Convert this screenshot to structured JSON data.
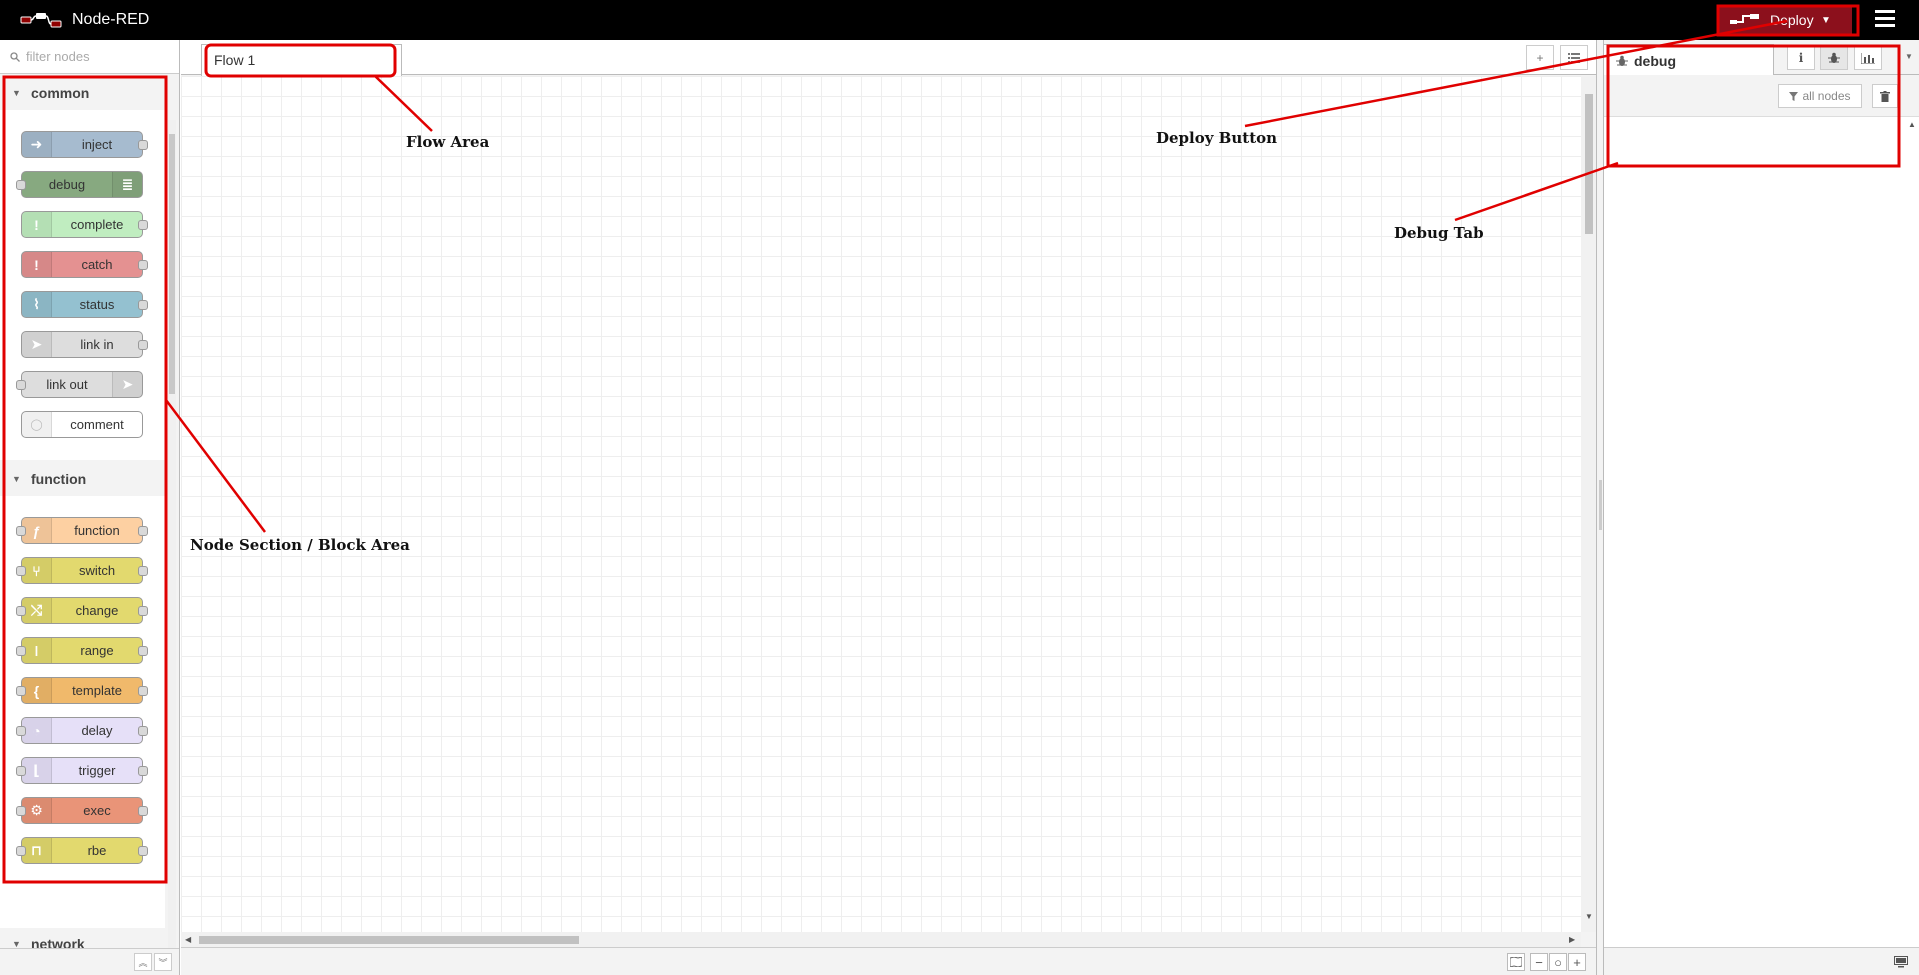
{
  "header": {
    "app_title": "Node-RED",
    "deploy_label": "Deploy"
  },
  "palette": {
    "search_placeholder": "filter nodes",
    "categories": [
      {
        "label": "common",
        "nodes": [
          {
            "label": "inject",
            "color": "#a6bbcf",
            "icon": "arrow-right-icon",
            "icon_side": "left",
            "in": false,
            "out": true
          },
          {
            "label": "debug",
            "color": "#87a980",
            "icon": "list-icon",
            "icon_side": "right",
            "in": true,
            "out": false
          },
          {
            "label": "complete",
            "color": "#c0edc0",
            "icon": "exclamation-icon",
            "icon_side": "left",
            "in": false,
            "out": true
          },
          {
            "label": "catch",
            "color": "#e49191",
            "icon": "exclamation-icon",
            "icon_side": "left",
            "in": false,
            "out": true
          },
          {
            "label": "status",
            "color": "#94c1d0",
            "icon": "pulse-icon",
            "icon_side": "left",
            "in": false,
            "out": true
          },
          {
            "label": "link in",
            "color": "#dddddd",
            "icon": "link-arrow-icon",
            "icon_side": "left",
            "in": false,
            "out": true
          },
          {
            "label": "link out",
            "color": "#dddddd",
            "icon": "link-arrow-icon",
            "icon_side": "right",
            "in": true,
            "out": false
          },
          {
            "label": "comment",
            "color": "#ffffff",
            "icon": "speech-bubble-icon",
            "icon_side": "left",
            "in": false,
            "out": false
          }
        ]
      },
      {
        "label": "function",
        "nodes": [
          {
            "label": "function",
            "color": "#fdd0a2",
            "icon": "function-icon",
            "icon_side": "left",
            "in": true,
            "out": true
          },
          {
            "label": "switch",
            "color": "#e2d96e",
            "icon": "switch-icon",
            "icon_side": "left",
            "in": true,
            "out": true
          },
          {
            "label": "change",
            "color": "#e2d96e",
            "icon": "shuffle-icon",
            "icon_side": "left",
            "in": true,
            "out": true
          },
          {
            "label": "range",
            "color": "#e2d96e",
            "icon": "range-icon",
            "icon_side": "left",
            "in": true,
            "out": true
          },
          {
            "label": "template",
            "color": "#f0b96b",
            "icon": "brace-icon",
            "icon_side": "left",
            "in": true,
            "out": true
          },
          {
            "label": "delay",
            "color": "#e6e0f8",
            "icon": "timer-icon",
            "icon_side": "left",
            "in": true,
            "out": true
          },
          {
            "label": "trigger",
            "color": "#e6e0f8",
            "icon": "trigger-icon",
            "icon_side": "left",
            "in": true,
            "out": true
          },
          {
            "label": "exec",
            "color": "#e99478",
            "icon": "gear-icon",
            "icon_side": "left",
            "in": true,
            "out": true
          },
          {
            "label": "rbe",
            "color": "#e2d96e",
            "icon": "rbe-icon",
            "icon_side": "left",
            "in": true,
            "out": true
          }
        ]
      },
      {
        "label": "network",
        "nodes": []
      }
    ]
  },
  "workspace": {
    "tabs": [
      {
        "label": "Flow 1"
      }
    ]
  },
  "sidebar": {
    "active_tab": "debug",
    "filter_label": "all nodes"
  },
  "annotations": {
    "flow_area": "Flow Area",
    "deploy_button": "Deploy Button",
    "debug_tab": "Debug Tab",
    "node_section": "Node Section / Block Area"
  },
  "colors": {
    "header_bg": "#000000",
    "deploy_bg": "#8c101c",
    "annotation": "#e00000"
  }
}
